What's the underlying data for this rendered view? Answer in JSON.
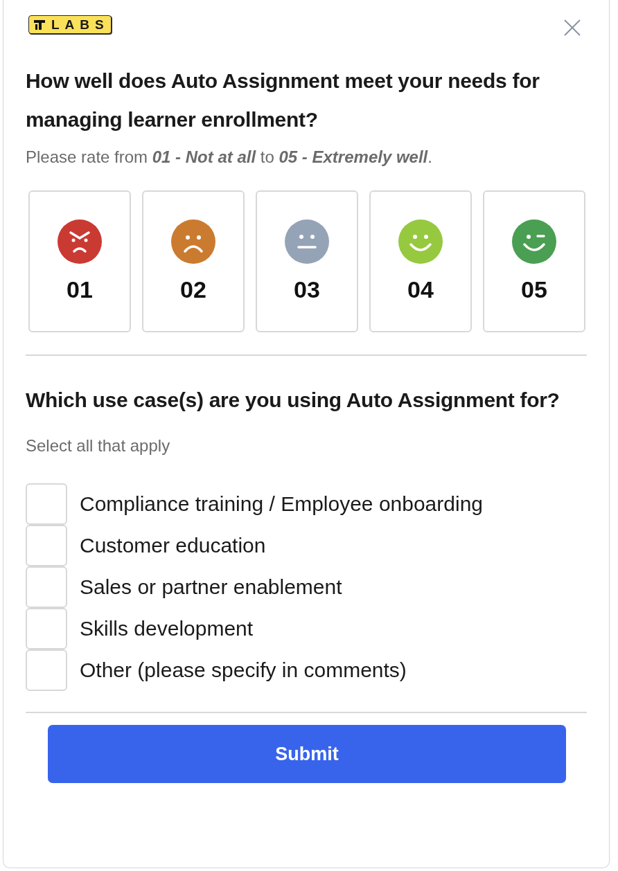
{
  "logo": {
    "text": "LABS"
  },
  "question_1": {
    "title": "How well does Auto Assignment meet your needs for managing learner enrollment?",
    "hint": "Please rate from **01 - Not at all** to **05 - Extremely well**.",
    "options": [
      {
        "label": "01",
        "kind": "angry",
        "color": "#c93a33",
        "selected": false
      },
      {
        "label": "02",
        "kind": "sad",
        "color": "#cb7b2f",
        "selected": false
      },
      {
        "label": "03",
        "kind": "neutral",
        "color": "#95a3b6",
        "selected": false
      },
      {
        "label": "04",
        "kind": "happy",
        "color": "#96c93f",
        "selected": false
      },
      {
        "label": "05",
        "kind": "wink",
        "color": "#4a9f52",
        "selected": false
      }
    ]
  },
  "question_2": {
    "title": "Which use case(s) are you using Auto Assignment for?",
    "hint": "Select all that apply",
    "options": [
      {
        "label": "Compliance training / Employee onboarding",
        "checked": false
      },
      {
        "label": "Customer education",
        "checked": false
      },
      {
        "label": "Sales or partner enablement",
        "checked": false
      },
      {
        "label": "Skills development",
        "checked": false
      },
      {
        "label": "Other (please specify in comments)",
        "checked": false
      }
    ]
  },
  "submit": {
    "label": "Submit"
  }
}
